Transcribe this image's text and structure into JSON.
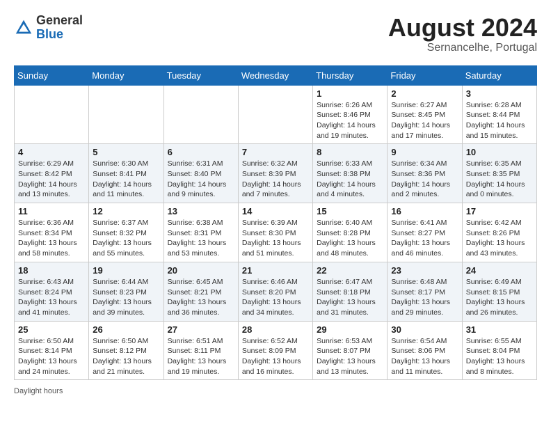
{
  "header": {
    "logo_general": "General",
    "logo_blue": "Blue",
    "month_year": "August 2024",
    "location": "Sernancelhe, Portugal"
  },
  "calendar": {
    "days_of_week": [
      "Sunday",
      "Monday",
      "Tuesday",
      "Wednesday",
      "Thursday",
      "Friday",
      "Saturday"
    ],
    "weeks": [
      [
        {
          "day": "",
          "info": ""
        },
        {
          "day": "",
          "info": ""
        },
        {
          "day": "",
          "info": ""
        },
        {
          "day": "",
          "info": ""
        },
        {
          "day": "1",
          "info": "Sunrise: 6:26 AM\nSunset: 8:46 PM\nDaylight: 14 hours and 19 minutes."
        },
        {
          "day": "2",
          "info": "Sunrise: 6:27 AM\nSunset: 8:45 PM\nDaylight: 14 hours and 17 minutes."
        },
        {
          "day": "3",
          "info": "Sunrise: 6:28 AM\nSunset: 8:44 PM\nDaylight: 14 hours and 15 minutes."
        }
      ],
      [
        {
          "day": "4",
          "info": "Sunrise: 6:29 AM\nSunset: 8:42 PM\nDaylight: 14 hours and 13 minutes."
        },
        {
          "day": "5",
          "info": "Sunrise: 6:30 AM\nSunset: 8:41 PM\nDaylight: 14 hours and 11 minutes."
        },
        {
          "day": "6",
          "info": "Sunrise: 6:31 AM\nSunset: 8:40 PM\nDaylight: 14 hours and 9 minutes."
        },
        {
          "day": "7",
          "info": "Sunrise: 6:32 AM\nSunset: 8:39 PM\nDaylight: 14 hours and 7 minutes."
        },
        {
          "day": "8",
          "info": "Sunrise: 6:33 AM\nSunset: 8:38 PM\nDaylight: 14 hours and 4 minutes."
        },
        {
          "day": "9",
          "info": "Sunrise: 6:34 AM\nSunset: 8:36 PM\nDaylight: 14 hours and 2 minutes."
        },
        {
          "day": "10",
          "info": "Sunrise: 6:35 AM\nSunset: 8:35 PM\nDaylight: 14 hours and 0 minutes."
        }
      ],
      [
        {
          "day": "11",
          "info": "Sunrise: 6:36 AM\nSunset: 8:34 PM\nDaylight: 13 hours and 58 minutes."
        },
        {
          "day": "12",
          "info": "Sunrise: 6:37 AM\nSunset: 8:32 PM\nDaylight: 13 hours and 55 minutes."
        },
        {
          "day": "13",
          "info": "Sunrise: 6:38 AM\nSunset: 8:31 PM\nDaylight: 13 hours and 53 minutes."
        },
        {
          "day": "14",
          "info": "Sunrise: 6:39 AM\nSunset: 8:30 PM\nDaylight: 13 hours and 51 minutes."
        },
        {
          "day": "15",
          "info": "Sunrise: 6:40 AM\nSunset: 8:28 PM\nDaylight: 13 hours and 48 minutes."
        },
        {
          "day": "16",
          "info": "Sunrise: 6:41 AM\nSunset: 8:27 PM\nDaylight: 13 hours and 46 minutes."
        },
        {
          "day": "17",
          "info": "Sunrise: 6:42 AM\nSunset: 8:26 PM\nDaylight: 13 hours and 43 minutes."
        }
      ],
      [
        {
          "day": "18",
          "info": "Sunrise: 6:43 AM\nSunset: 8:24 PM\nDaylight: 13 hours and 41 minutes."
        },
        {
          "day": "19",
          "info": "Sunrise: 6:44 AM\nSunset: 8:23 PM\nDaylight: 13 hours and 39 minutes."
        },
        {
          "day": "20",
          "info": "Sunrise: 6:45 AM\nSunset: 8:21 PM\nDaylight: 13 hours and 36 minutes."
        },
        {
          "day": "21",
          "info": "Sunrise: 6:46 AM\nSunset: 8:20 PM\nDaylight: 13 hours and 34 minutes."
        },
        {
          "day": "22",
          "info": "Sunrise: 6:47 AM\nSunset: 8:18 PM\nDaylight: 13 hours and 31 minutes."
        },
        {
          "day": "23",
          "info": "Sunrise: 6:48 AM\nSunset: 8:17 PM\nDaylight: 13 hours and 29 minutes."
        },
        {
          "day": "24",
          "info": "Sunrise: 6:49 AM\nSunset: 8:15 PM\nDaylight: 13 hours and 26 minutes."
        }
      ],
      [
        {
          "day": "25",
          "info": "Sunrise: 6:50 AM\nSunset: 8:14 PM\nDaylight: 13 hours and 24 minutes."
        },
        {
          "day": "26",
          "info": "Sunrise: 6:50 AM\nSunset: 8:12 PM\nDaylight: 13 hours and 21 minutes."
        },
        {
          "day": "27",
          "info": "Sunrise: 6:51 AM\nSunset: 8:11 PM\nDaylight: 13 hours and 19 minutes."
        },
        {
          "day": "28",
          "info": "Sunrise: 6:52 AM\nSunset: 8:09 PM\nDaylight: 13 hours and 16 minutes."
        },
        {
          "day": "29",
          "info": "Sunrise: 6:53 AM\nSunset: 8:07 PM\nDaylight: 13 hours and 13 minutes."
        },
        {
          "day": "30",
          "info": "Sunrise: 6:54 AM\nSunset: 8:06 PM\nDaylight: 13 hours and 11 minutes."
        },
        {
          "day": "31",
          "info": "Sunrise: 6:55 AM\nSunset: 8:04 PM\nDaylight: 13 hours and 8 minutes."
        }
      ]
    ]
  },
  "footer": {
    "daylight_label": "Daylight hours"
  }
}
